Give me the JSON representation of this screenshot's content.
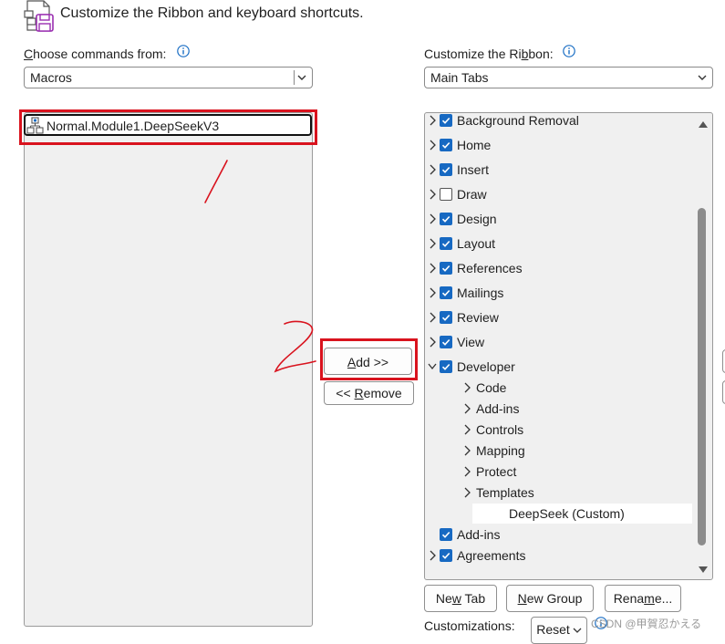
{
  "header": {
    "title": "Customize the Ribbon and keyboard shortcuts.",
    "icon": "ribbon-customize-icon"
  },
  "left": {
    "label": "Choose commands from:",
    "label_accesskey": "C",
    "label_rest": "hoose commands from:",
    "combo_value": "Macros",
    "commands": [
      {
        "label": "Normal.Module1.DeepSeekV3",
        "icon": "macro-icon",
        "selected": true
      }
    ]
  },
  "right": {
    "label_pre": "Customize the Ri",
    "label_accesskey": "b",
    "label_post": "bon:",
    "combo_value": "Main Tabs",
    "tree": [
      {
        "label": "Background Removal",
        "level": 0,
        "checked": true,
        "expander": "collapsed"
      },
      {
        "label": "Home",
        "level": 0,
        "checked": true,
        "expander": "collapsed"
      },
      {
        "label": "Insert",
        "level": 0,
        "checked": true,
        "expander": "collapsed"
      },
      {
        "label": "Draw",
        "level": 0,
        "checked": false,
        "expander": "collapsed"
      },
      {
        "label": "Design",
        "level": 0,
        "checked": true,
        "expander": "collapsed"
      },
      {
        "label": "Layout",
        "level": 0,
        "checked": true,
        "expander": "collapsed"
      },
      {
        "label": "References",
        "level": 0,
        "checked": true,
        "expander": "collapsed"
      },
      {
        "label": "Mailings",
        "level": 0,
        "checked": true,
        "expander": "collapsed"
      },
      {
        "label": "Review",
        "level": 0,
        "checked": true,
        "expander": "collapsed"
      },
      {
        "label": "View",
        "level": 0,
        "checked": true,
        "expander": "collapsed"
      },
      {
        "label": "Developer",
        "level": 0,
        "checked": true,
        "expander": "expanded"
      },
      {
        "label": "Code",
        "level": 1,
        "checked": null,
        "expander": "collapsed"
      },
      {
        "label": "Add-ins",
        "level": 1,
        "checked": null,
        "expander": "collapsed"
      },
      {
        "label": "Controls",
        "level": 1,
        "checked": null,
        "expander": "collapsed"
      },
      {
        "label": "Mapping",
        "level": 1,
        "checked": null,
        "expander": "collapsed"
      },
      {
        "label": "Protect",
        "level": 1,
        "checked": null,
        "expander": "collapsed"
      },
      {
        "label": "Templates",
        "level": 1,
        "checked": null,
        "expander": "collapsed"
      },
      {
        "label": "DeepSeek (Custom)",
        "level": 1,
        "checked": null,
        "expander": "none",
        "highlighted": true
      },
      {
        "label": "Add-ins",
        "level": 0,
        "checked": true,
        "expander": "none"
      },
      {
        "label": "Agreements",
        "level": 0,
        "checked": true,
        "expander": "collapsed"
      }
    ]
  },
  "middle": {
    "add": {
      "accesskey": "A",
      "rest": "dd >>"
    },
    "remove": {
      "pre": "<< ",
      "accesskey": "R",
      "rest": "emove"
    }
  },
  "bottom": {
    "new_tab": {
      "pre": "Ne",
      "accesskey": "w",
      "post": " Tab"
    },
    "new_group": {
      "pre": "",
      "accesskey": "N",
      "post": "ew Group"
    },
    "rename": {
      "pre": "Rena",
      "accesskey": "m",
      "post": "e..."
    },
    "customizations_label": "Customizations:",
    "reset_label": "Reset"
  },
  "annotations": {
    "step1": "1",
    "step2": "2",
    "color": "#d9131e"
  },
  "watermark": "CSDN @甲賀忍かえる",
  "colors": {
    "checkbox_on": "#1769c2",
    "list_bg": "#f0f0f0",
    "info_icon": "#1a6ec4"
  }
}
